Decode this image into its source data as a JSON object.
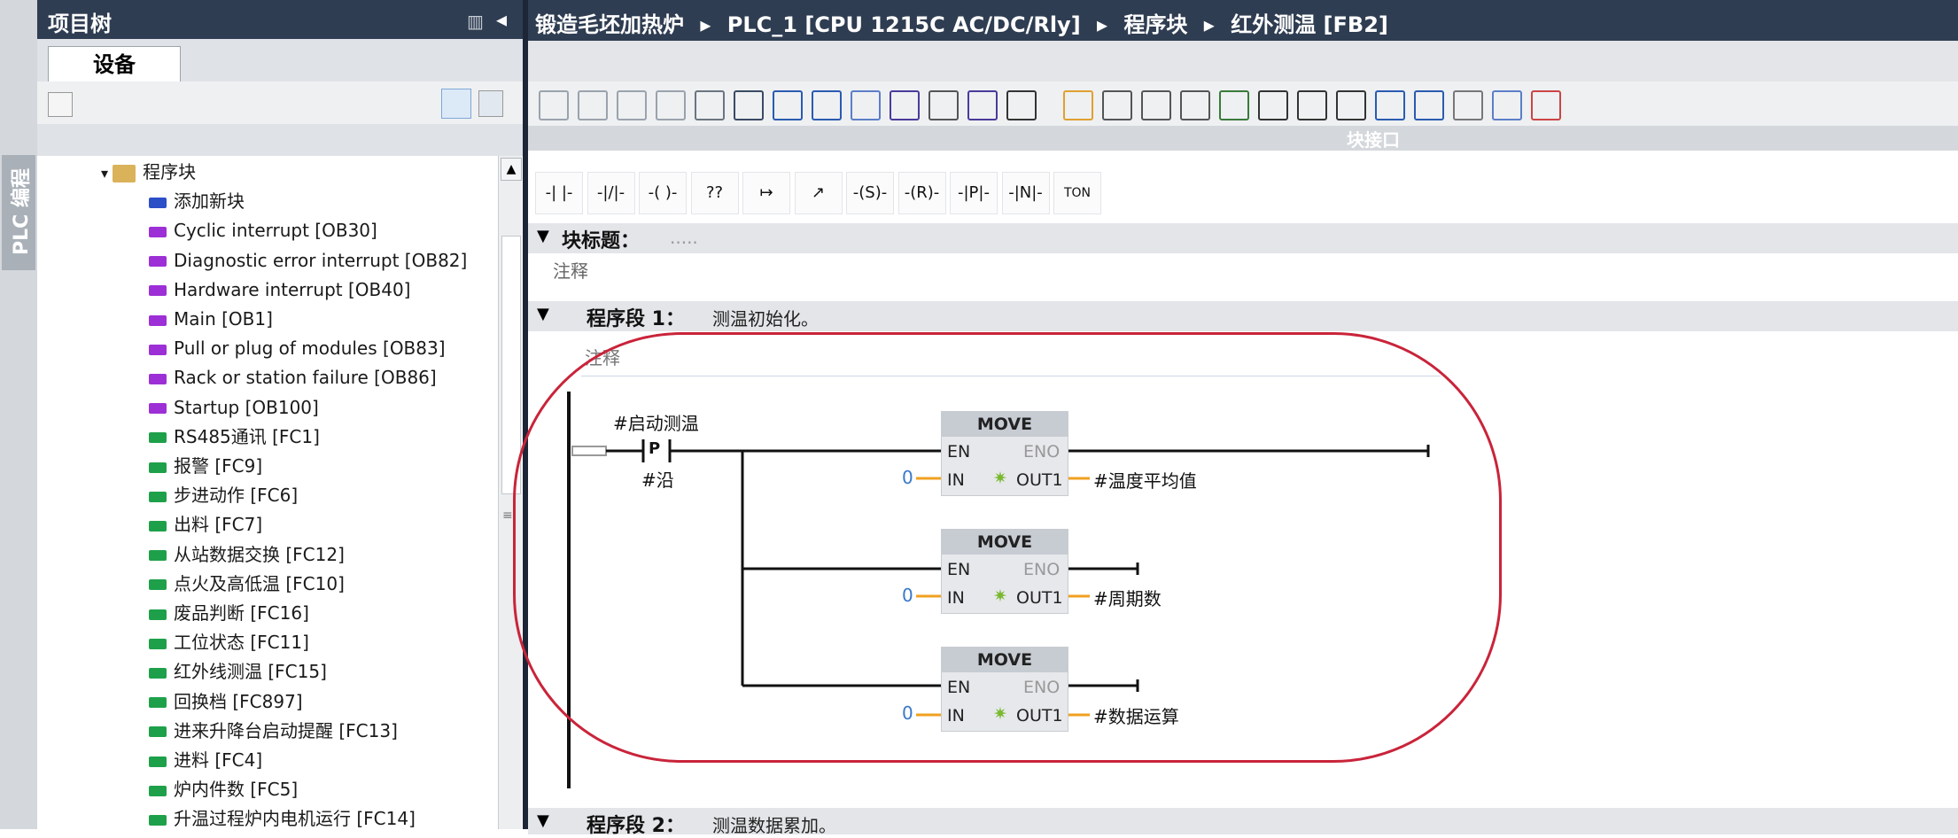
{
  "side_strip": {
    "label": "PLC 编程"
  },
  "tree": {
    "title": "项目树",
    "tab": "设备",
    "items": [
      {
        "label": "程序块",
        "kind": "folder"
      },
      {
        "label": "添加新块",
        "kind": "add"
      },
      {
        "label": "Cyclic interrupt [OB30]",
        "kind": "ob"
      },
      {
        "label": "Diagnostic error interrupt [OB82]",
        "kind": "ob"
      },
      {
        "label": "Hardware interrupt [OB40]",
        "kind": "ob"
      },
      {
        "label": "Main [OB1]",
        "kind": "ob"
      },
      {
        "label": "Pull or plug of modules [OB83]",
        "kind": "ob"
      },
      {
        "label": "Rack or station failure [OB86]",
        "kind": "ob"
      },
      {
        "label": "Startup [OB100]",
        "kind": "ob"
      },
      {
        "label": "RS485通讯 [FC1]",
        "kind": "fc"
      },
      {
        "label": "报警 [FC9]",
        "kind": "fc"
      },
      {
        "label": "步进动作 [FC6]",
        "kind": "fc"
      },
      {
        "label": "出料 [FC7]",
        "kind": "fc"
      },
      {
        "label": "从站数据交换 [FC12]",
        "kind": "fc"
      },
      {
        "label": "点火及高低温 [FC10]",
        "kind": "fc"
      },
      {
        "label": "废品判断 [FC16]",
        "kind": "fc"
      },
      {
        "label": "工位状态 [FC11]",
        "kind": "fc"
      },
      {
        "label": "红外线测温 [FC15]",
        "kind": "fc"
      },
      {
        "label": "回换档 [FC897]",
        "kind": "fc"
      },
      {
        "label": "进来升降台启动提醒 [FC13]",
        "kind": "fc"
      },
      {
        "label": "进料 [FC4]",
        "kind": "fc"
      },
      {
        "label": "炉内件数 [FC5]",
        "kind": "fc"
      },
      {
        "label": "升温过程炉内电机运行 [FC14]",
        "kind": "fc"
      }
    ]
  },
  "editor": {
    "breadcrumb": [
      "锻造毛坯加热炉",
      "PLC_1 [CPU 1215C AC/DC/Rly]",
      "程序块",
      "红外测温 [FB2]"
    ],
    "interface_label": "块接口",
    "instructions": [
      "-| |-",
      "-|/|-",
      "-( )-",
      "??",
      "↦",
      "↗",
      "-(S)-",
      "-(R)-",
      "-|P|-",
      "-|N|-",
      "TON"
    ],
    "block_title_label": "块标题：",
    "block_title_value": ".....",
    "block_comment": "注释",
    "network1": {
      "label": "程序段 1：",
      "description": "测温初始化。",
      "comment": "注释",
      "contact_var": "#启动测温",
      "contact_type": "P",
      "edge_var": "#沿",
      "moves": [
        {
          "title": "MOVE",
          "en": "EN",
          "eno": "ENO",
          "in": "IN",
          "out": "OUT1",
          "in_value": "0",
          "out_var": "#温度平均值"
        },
        {
          "title": "MOVE",
          "en": "EN",
          "eno": "ENO",
          "in": "IN",
          "out": "OUT1",
          "in_value": "0",
          "out_var": "#周期数"
        },
        {
          "title": "MOVE",
          "en": "EN",
          "eno": "ENO",
          "in": "IN",
          "out": "OUT1",
          "in_value": "0",
          "out_var": "#数据运算"
        }
      ]
    },
    "network2": {
      "label": "程序段 2：",
      "description": "测温数据累加。"
    }
  },
  "colors": {
    "header": "#2f3d52",
    "ob_icon": "#9d2fd6",
    "fc_icon": "#1ea04a",
    "highlight_ring": "#c9243a",
    "wire_orange": "#f0a020"
  }
}
